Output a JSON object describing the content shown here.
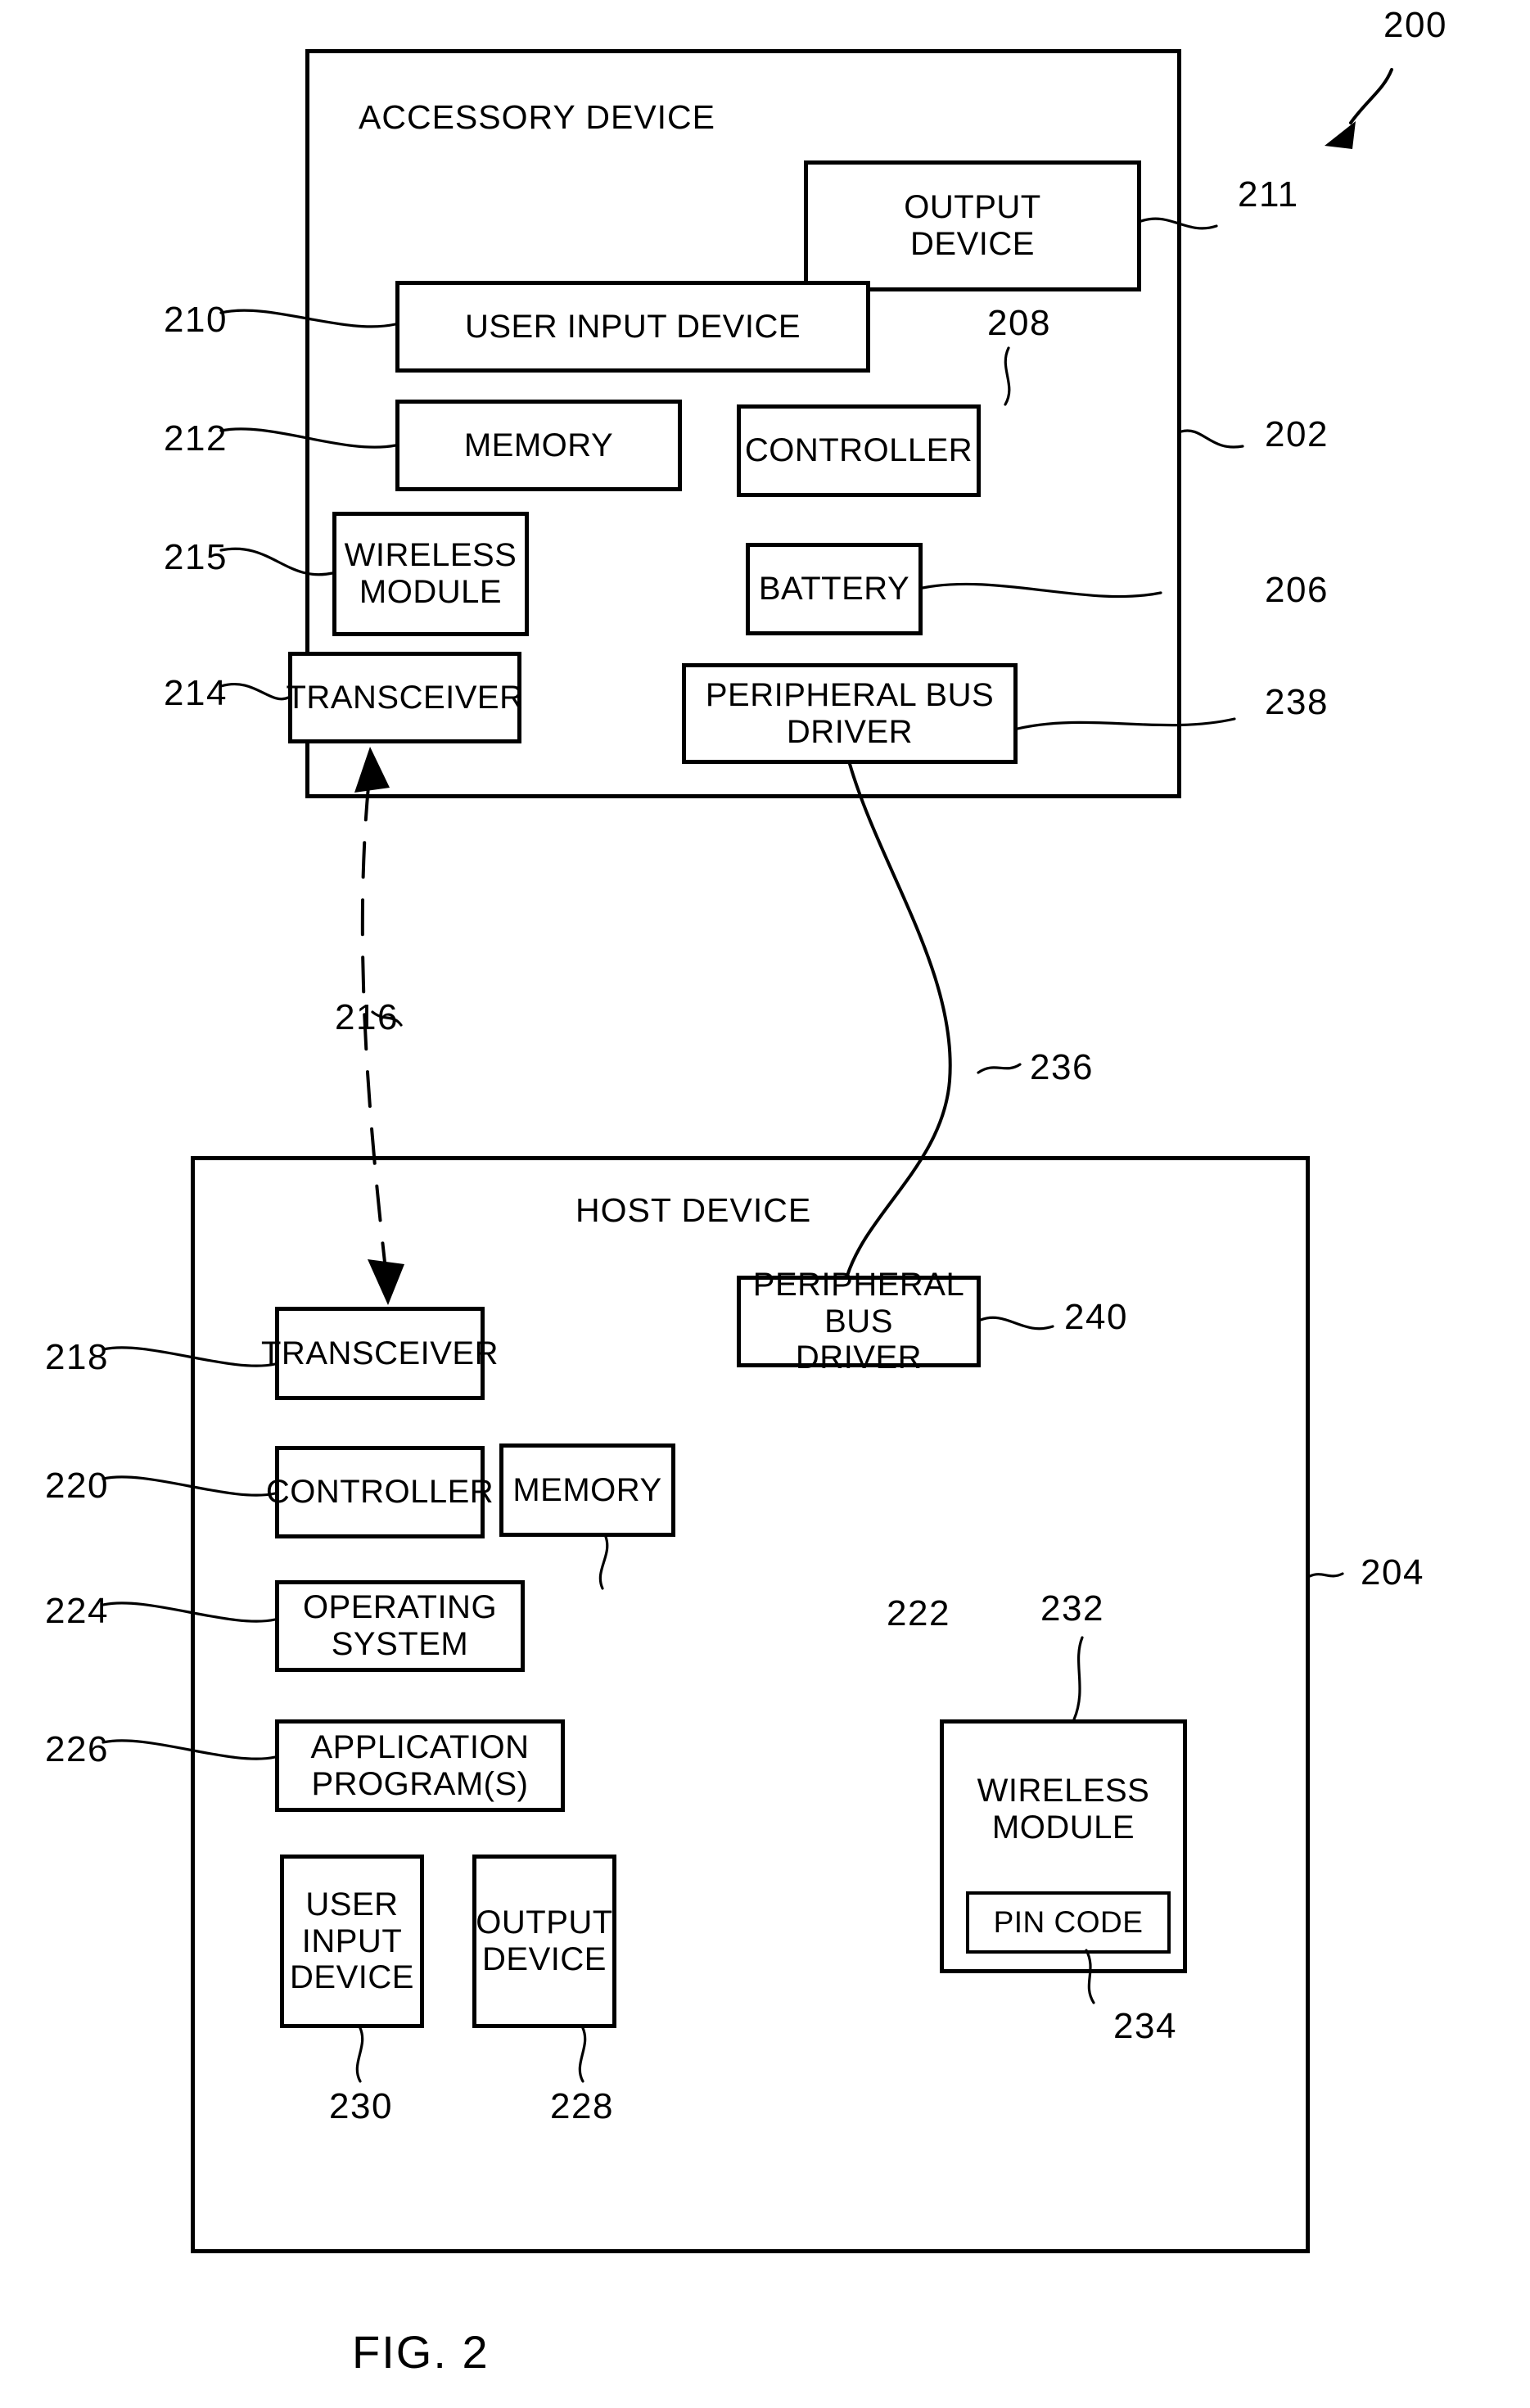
{
  "figure": {
    "caption": "FIG. 2",
    "figure_ref": "200"
  },
  "accessory_device": {
    "title": "ACCESSORY DEVICE",
    "ref": "202",
    "components": [
      {
        "label": "OUTPUT\nDEVICE",
        "ref": "211"
      },
      {
        "label": "USER INPUT DEVICE",
        "ref": "210"
      },
      {
        "label": "MEMORY",
        "ref": "212"
      },
      {
        "label": "CONTROLLER",
        "ref": "208"
      },
      {
        "label": "WIRELESS\nMODULE",
        "ref": "215"
      },
      {
        "label": "BATTERY",
        "ref": "206"
      },
      {
        "label": "TRANSCEIVER",
        "ref": "214"
      },
      {
        "label": "PERIPHERAL BUS\nDRIVER",
        "ref": "238"
      }
    ]
  },
  "host_device": {
    "title": "HOST DEVICE",
    "ref": "204",
    "components": [
      {
        "label": "TRANSCEIVER",
        "ref": "218"
      },
      {
        "label": "PERIPHERAL BUS\nDRIVER",
        "ref": "240"
      },
      {
        "label": "CONTROLLER",
        "ref": "220"
      },
      {
        "label": "MEMORY",
        "ref": "222"
      },
      {
        "label": "OPERATING SYSTEM",
        "ref": "224"
      },
      {
        "label": "APPLICATION PROGRAM(S)",
        "ref": "226"
      },
      {
        "label": "USER\nINPUT\nDEVICE",
        "ref": "230"
      },
      {
        "label": "OUTPUT\nDEVICE",
        "ref": "228"
      },
      {
        "label": "WIRELESS\nMODULE",
        "ref": "232"
      },
      {
        "label": "PIN CODE",
        "ref": "234"
      }
    ]
  },
  "connections": [
    {
      "name": "wireless-link",
      "ref": "216",
      "style": "dashed",
      "from": "host-transceiver",
      "to": "accessory-transceiver"
    },
    {
      "name": "peripheral-bus-link",
      "ref": "236",
      "style": "solid",
      "from": "accessory-peripheral-bus-driver",
      "to": "host-peripheral-bus-driver"
    }
  ]
}
